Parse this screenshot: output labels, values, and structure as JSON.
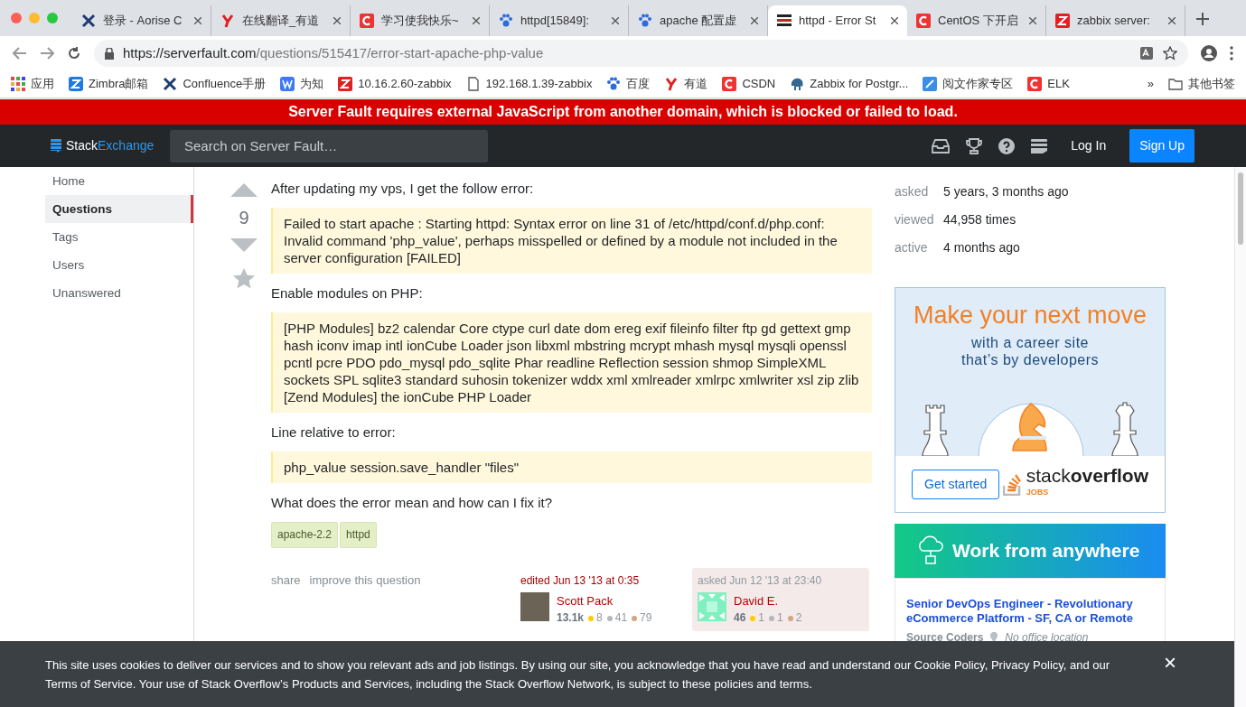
{
  "browser": {
    "tabs": [
      {
        "title": "登录 - Aorise C",
        "selected": false
      },
      {
        "title": "在线翻译_有道",
        "selected": false
      },
      {
        "title": "学习使我快乐~",
        "selected": false
      },
      {
        "title": "httpd[15849]:",
        "selected": false
      },
      {
        "title": "apache 配置虚",
        "selected": false
      },
      {
        "title": "httpd - Error St",
        "selected": true
      },
      {
        "title": "CentOS 下开启",
        "selected": false
      },
      {
        "title": "zabbix server:",
        "selected": false
      }
    ],
    "address": {
      "host": "https://serverfault.com",
      "path": "/questions/515417/error-start-apache-php-value"
    },
    "bookmarks": [
      {
        "label": "应用"
      },
      {
        "label": "Zimbra邮箱"
      },
      {
        "label": "Confluence手册"
      },
      {
        "label": "为知"
      },
      {
        "label": "10.16.2.60-zabbix"
      },
      {
        "label": "192.168.1.39-zabbix"
      },
      {
        "label": "百度"
      },
      {
        "label": "有道"
      },
      {
        "label": "CSDN"
      },
      {
        "label": "Zabbix for Postgr..."
      },
      {
        "label": "阅文作家专区"
      },
      {
        "label": "ELK"
      }
    ],
    "more": "»",
    "other_bookmarks": "其他书签"
  },
  "banner": "Server Fault requires external JavaScript from another domain, which is blocked or failed to load.",
  "header": {
    "logo_first": "Stack",
    "logo_second": "Exchange",
    "search": {
      "placeholder": "Search on Server Fault…"
    },
    "login": "Log In",
    "signup": "Sign Up"
  },
  "sidebar": {
    "items": [
      {
        "label": "Home",
        "selected": false
      },
      {
        "label": "Questions",
        "selected": true
      },
      {
        "label": "Tags",
        "selected": false
      },
      {
        "label": "Users",
        "selected": false
      },
      {
        "label": "Unanswered",
        "selected": false
      }
    ]
  },
  "question": {
    "votes": "9",
    "body": [
      {
        "kind": "text",
        "text": "After updating my vps, I get the follow error:"
      },
      {
        "kind": "quote",
        "text": "Failed to start apache : Starting httpd: Syntax error on line 31 of /etc/httpd/conf.d/php.conf: Invalid command 'php_value', perhaps misspelled or defined by a module not included in the server configuration [FAILED]"
      },
      {
        "kind": "text",
        "text": "Enable modules on PHP:"
      },
      {
        "kind": "quote",
        "text": "[PHP Modules] bz2 calendar Core ctype curl date dom ereg exif fileinfo filter ftp gd gettext gmp hash iconv imap intl ionCube Loader json libxml mbstring mcrypt mhash mysql mysqli openssl pcntl pcre PDO pdo_mysql pdo_sqlite Phar readline Reflection session shmop SimpleXML sockets SPL sqlite3 standard suhosin tokenizer wddx xml xmlreader xmlrpc xmlwriter xsl zip zlib [Zend Modules] the ionCube PHP Loader"
      },
      {
        "kind": "text",
        "text": "Line relative to error:"
      },
      {
        "kind": "quote",
        "text": "php_value session.save_handler \"files\""
      },
      {
        "kind": "text",
        "text": "What does the error mean and how can I fix it?"
      }
    ],
    "tags": [
      "apache-2.2",
      "httpd"
    ],
    "actions": [
      "share",
      "improve this question"
    ],
    "editor": {
      "action": "edited Jun 13 '13 at 0:35",
      "name": "Scott Pack",
      "rep": "13.1k",
      "gold": "8",
      "silver": "41",
      "bronze": "79"
    },
    "asker": {
      "action": "asked Jun 12 '13 at 23:40",
      "name": "David E.",
      "rep": "46",
      "gold": "1",
      "silver": "1",
      "bronze": "2"
    }
  },
  "stats": [
    {
      "label": "asked",
      "value": "5 years, 3 months ago"
    },
    {
      "label": "viewed",
      "value": "44,958 times"
    },
    {
      "label": "active",
      "value": "4 months ago"
    }
  ],
  "ad": {
    "headline": "Make your next move",
    "subline_1": "with a career site",
    "subline_2": "that’s by developers",
    "button": "Get started",
    "logo_first": "stack",
    "logo_second": "overflow",
    "logo_tag": "JOBS"
  },
  "job_ad": {
    "banner": "Work from anywhere",
    "title": "Senior DevOps Engineer - Revolutionary eCommerce Platform - SF, CA or Remote",
    "company": "Source Coders",
    "location": "No office location"
  },
  "cookie_notice": {
    "parts": [
      {
        "text": "This site uses cookies to deliver our services and to show you relevant ads and job listings. By using our site, you acknowledge that you have read and understand our ",
        "link": false
      },
      {
        "text": "Cookie Policy",
        "link": true
      },
      {
        "text": ", ",
        "link": false
      },
      {
        "text": "Privacy Policy",
        "link": true
      },
      {
        "text": ", and our ",
        "link": false
      },
      {
        "text": "Terms of Service",
        "link": true
      },
      {
        "text": ". Your use of Stack Overflow’s Products and Services, including the Stack Overflow Network, is subject to these policies and terms.",
        "link": false
      }
    ],
    "close": "×"
  }
}
